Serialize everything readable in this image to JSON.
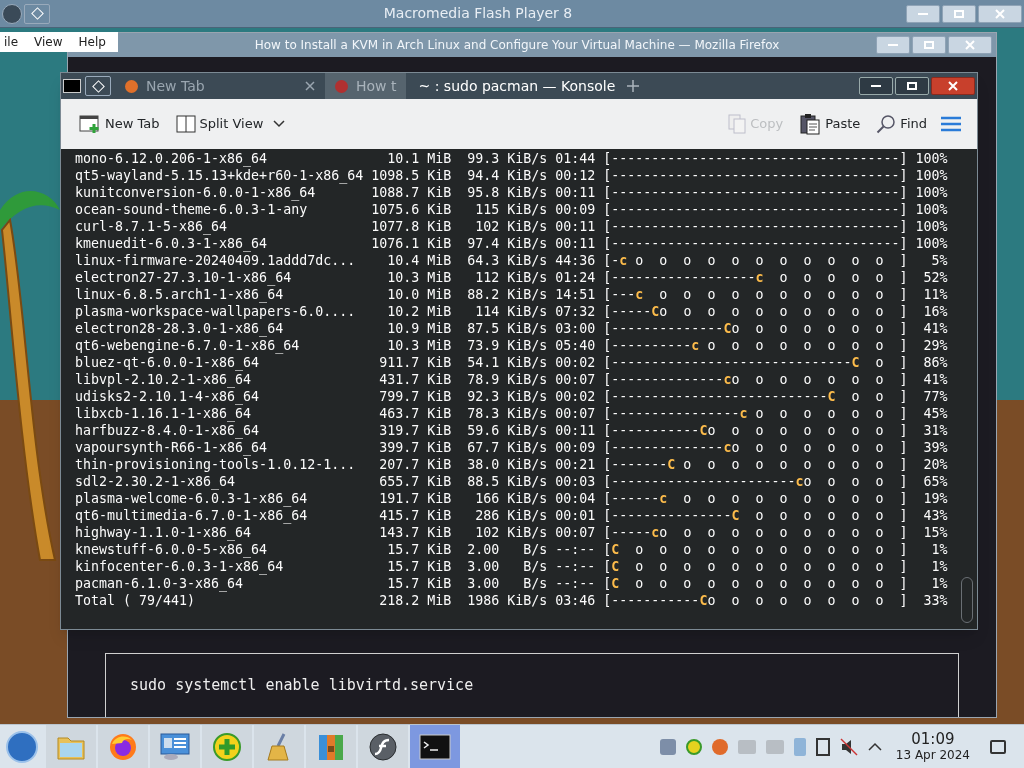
{
  "flash_window": {
    "title": "Macromedia Flash Player 8",
    "menu": [
      "ile",
      "View",
      "Help"
    ]
  },
  "browser_window": {
    "title": "How to Install a KVM in Arch Linux and Configure Your Virtual Machine — Mozilla Firefox",
    "tabs": [
      {
        "label": "New Tab",
        "selected": false
      },
      {
        "label": "How t",
        "selected": true
      }
    ],
    "code": "sudo systemctl enable libvirtd.service"
  },
  "konsole": {
    "title": "~ : sudo pacman — Konsole",
    "toolbar": [
      {
        "kind": "new-tab",
        "label": "New Tab",
        "disabled": false
      },
      {
        "kind": "split-view",
        "label": "Split View",
        "disabled": false
      },
      {
        "kind": "copy",
        "label": "Copy",
        "disabled": true
      },
      {
        "kind": "paste",
        "label": "Paste",
        "disabled": false
      },
      {
        "kind": "find",
        "label": "Find",
        "disabled": false
      }
    ],
    "rows": [
      {
        "name": "mono-6.12.0.206-1-x86_64",
        "size": "10.1 MiB",
        "speed": "99.3 KiB/s",
        "eta": "01:44",
        "bar_head": "[------------------------------------]",
        "percent": "100%"
      },
      {
        "name": "qt5-wayland-5.15.13+kde+r60-1-x86_64",
        "size": "1098.5 KiB",
        "speed": "94.4 KiB/s",
        "eta": "00:12",
        "bar_head": "[------------------------------------]",
        "percent": "100%"
      },
      {
        "name": "kunitconversion-6.0.0-1-x86_64",
        "size": "1088.7 KiB",
        "speed": "95.8 KiB/s",
        "eta": "00:11",
        "bar_head": "[------------------------------------]",
        "percent": "100%"
      },
      {
        "name": "ocean-sound-theme-6.0.3-1-any",
        "size": "1075.6 KiB",
        "speed": "115 KiB/s",
        "eta": "00:09",
        "bar_head": "[------------------------------------]",
        "percent": "100%"
      },
      {
        "name": "curl-8.7.1-5-x86_64",
        "size": "1077.8 KiB",
        "speed": "102 KiB/s",
        "eta": "00:11",
        "bar_head": "[------------------------------------]",
        "percent": "100%"
      },
      {
        "name": "kmenuedit-6.0.3-1-x86_64",
        "size": "1076.1 KiB",
        "speed": "97.4 KiB/s",
        "eta": "00:11",
        "bar_head": "[------------------------------------]",
        "percent": "100%"
      },
      {
        "name": "linux-firmware-20240409.1addd7dc...",
        "size": "10.4 MiB",
        "speed": "64.3 KiB/s",
        "eta": "44:36",
        "bar_head": "[-",
        "pac": "c",
        "bar_tail": " o  o  o  o  o  o  o  o  o  o  o  ]",
        "percent": "5%"
      },
      {
        "name": "electron27-27.3.10-1-x86_64",
        "size": "10.3 MiB",
        "speed": "112 KiB/s",
        "eta": "01:24",
        "bar_head": "[------------------",
        "pac": "c",
        "bar_tail": "  o  o  o  o  o  ]",
        "percent": "52%"
      },
      {
        "name": "linux-6.8.5.arch1-1-x86_64",
        "size": "10.0 MiB",
        "speed": "88.2 KiB/s",
        "eta": "14:51",
        "bar_head": "[---",
        "pac": "c",
        "bar_tail": "  o  o  o  o  o  o  o  o  o  o  ]",
        "percent": "11%"
      },
      {
        "name": "plasma-workspace-wallpapers-6.0....",
        "size": "10.2 MiB",
        "speed": "114 KiB/s",
        "eta": "07:32",
        "bar_head": "[-----",
        "pac": "C",
        "bar_tail": "o  o  o  o  o  o  o  o  o  o  ]",
        "percent": "16%"
      },
      {
        "name": "electron28-28.3.0-1-x86_64",
        "size": "10.9 MiB",
        "speed": "87.5 KiB/s",
        "eta": "03:00",
        "bar_head": "[--------------",
        "pac": "C",
        "bar_tail": "o  o  o  o  o  o  o  ]",
        "percent": "41%"
      },
      {
        "name": "qt6-webengine-6.7.0-1-x86_64",
        "size": "10.3 MiB",
        "speed": "73.9 KiB/s",
        "eta": "05:40",
        "bar_head": "[----------",
        "pac": "c",
        "bar_tail": " o  o  o  o  o  o  o  o  ]",
        "percent": "29%"
      },
      {
        "name": "bluez-qt-6.0.0-1-x86_64",
        "size": "911.7 KiB",
        "speed": "54.1 KiB/s",
        "eta": "00:02",
        "bar_head": "[------------------------------",
        "pac": "C",
        "bar_tail": "  o  ]",
        "percent": "86%"
      },
      {
        "name": "libvpl-2.10.2-1-x86_64",
        "size": "431.7 KiB",
        "speed": "78.9 KiB/s",
        "eta": "00:07",
        "bar_head": "[--------------",
        "pac": "c",
        "bar_tail": "o  o  o  o  o  o  o  ]",
        "percent": "41%"
      },
      {
        "name": "udisks2-2.10.1-4-x86_64",
        "size": "799.7 KiB",
        "speed": "92.3 KiB/s",
        "eta": "00:02",
        "bar_head": "[---------------------------",
        "pac": "C",
        "bar_tail": "  o  o  ]",
        "percent": "77%"
      },
      {
        "name": "libxcb-1.16.1-1-x86_64",
        "size": "463.7 KiB",
        "speed": "78.3 KiB/s",
        "eta": "00:07",
        "bar_head": "[----------------",
        "pac": "c",
        "bar_tail": " o  o  o  o  o  o  ]",
        "percent": "45%"
      },
      {
        "name": "harfbuzz-8.4.0-1-x86_64",
        "size": "319.7 KiB",
        "speed": "59.6 KiB/s",
        "eta": "00:11",
        "bar_head": "[-----------",
        "pac": "C",
        "bar_tail": "o  o  o  o  o  o  o  o  ]",
        "percent": "31%"
      },
      {
        "name": "vapoursynth-R66-1-x86_64",
        "size": "399.7 KiB",
        "speed": "67.7 KiB/s",
        "eta": "00:09",
        "bar_head": "[--------------",
        "pac": "c",
        "bar_tail": "o  o  o  o  o  o  o  ]",
        "percent": "39%"
      },
      {
        "name": "thin-provisioning-tools-1.0.12-1...",
        "size": "207.7 KiB",
        "speed": "38.0 KiB/s",
        "eta": "00:21",
        "bar_head": "[-------",
        "pac": "C",
        "bar_tail": " o  o  o  o  o  o  o  o  o  ]",
        "percent": "20%"
      },
      {
        "name": "sdl2-2.30.2-1-x86_64",
        "size": "655.7 KiB",
        "speed": "88.5 KiB/s",
        "eta": "00:03",
        "bar_head": "[-----------------------",
        "pac": "c",
        "bar_tail": "o  o  o  o  ]",
        "percent": "65%"
      },
      {
        "name": "plasma-welcome-6.0.3-1-x86_64",
        "size": "191.7 KiB",
        "speed": "166 KiB/s",
        "eta": "00:04",
        "bar_head": "[------",
        "pac": "c",
        "bar_tail": "  o  o  o  o  o  o  o  o  o  ]",
        "percent": "19%"
      },
      {
        "name": "qt6-multimedia-6.7.0-1-x86_64",
        "size": "415.7 KiB",
        "speed": "286 KiB/s",
        "eta": "00:01",
        "bar_head": "[---------------",
        "pac": "C",
        "bar_tail": "  o  o  o  o  o  o  ]",
        "percent": "43%"
      },
      {
        "name": "highway-1.1.0-1-x86_64",
        "size": "143.7 KiB",
        "speed": "102 KiB/s",
        "eta": "00:07",
        "bar_head": "[-----",
        "pac": "c",
        "bar_tail": "o  o  o  o  o  o  o  o  o  o  ]",
        "percent": "15%"
      },
      {
        "name": "knewstuff-6.0.0-5-x86_64",
        "size": "15.7 KiB",
        "speed": "2.00   B/s",
        "eta": "--:--",
        "bar_head": "[",
        "pac": "C",
        "bar_tail": "  o  o  o  o  o  o  o  o  o  o  o  ]",
        "percent": "1%"
      },
      {
        "name": "kinfocenter-6.0.3-1-x86_64",
        "size": "15.7 KiB",
        "speed": "3.00   B/s",
        "eta": "--:--",
        "bar_head": "[",
        "pac": "C",
        "bar_tail": "  o  o  o  o  o  o  o  o  o  o  o  ]",
        "percent": "1%"
      },
      {
        "name": "pacman-6.1.0-3-x86_64",
        "size": "15.7 KiB",
        "speed": "3.00   B/s",
        "eta": "--:--",
        "bar_head": "[",
        "pac": "C",
        "bar_tail": "  o  o  o  o  o  o  o  o  o  o  o  ]",
        "percent": "1%"
      },
      {
        "name": "Total ( 79/441)",
        "size": "218.2 MiB",
        "speed": "1986 KiB/s",
        "eta": "03:46",
        "bar_head": "[-----------",
        "pac": "C",
        "bar_tail": "o  o  o  o  o  o  o  o  ]",
        "percent": "33%"
      }
    ]
  },
  "taskbar": {
    "apps": [
      {
        "kind": "folder",
        "selected": false
      },
      {
        "kind": "firefox",
        "selected": false
      },
      {
        "kind": "presentation",
        "selected": false
      },
      {
        "kind": "plus",
        "selected": false
      },
      {
        "kind": "broom",
        "selected": false
      },
      {
        "kind": "archive",
        "selected": false
      },
      {
        "kind": "flash",
        "selected": false
      },
      {
        "kind": "terminal",
        "selected": true
      }
    ],
    "clock": {
      "time": "01:09",
      "date": "13 Apr 2024"
    }
  }
}
